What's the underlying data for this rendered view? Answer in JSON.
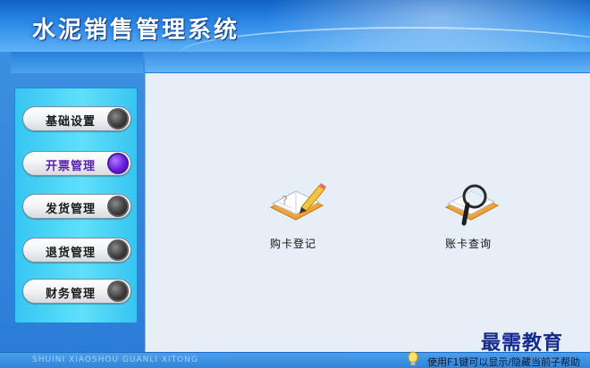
{
  "header": {
    "title": "水泥销售管理系统"
  },
  "sidebar": {
    "items": [
      {
        "label": "基础设置",
        "active": false
      },
      {
        "label": "开票管理",
        "active": true
      },
      {
        "label": "发货管理",
        "active": false
      },
      {
        "label": "退货管理",
        "active": false
      },
      {
        "label": "财务管理",
        "active": false
      }
    ]
  },
  "main": {
    "functions": [
      {
        "label": "购卡登记",
        "icon": "notebook-pen-icon"
      },
      {
        "label": "账卡查询",
        "icon": "book-magnifier-icon"
      }
    ]
  },
  "status": {
    "brand": "SHUINI XIAOSHOU GUANLI XITONG",
    "tip": "使用F1键可以显示/隐藏当前子帮助"
  },
  "watermark": "最需教育",
  "colors": {
    "active_knob": "#6a20e0",
    "accent": "#2d8ae8"
  }
}
